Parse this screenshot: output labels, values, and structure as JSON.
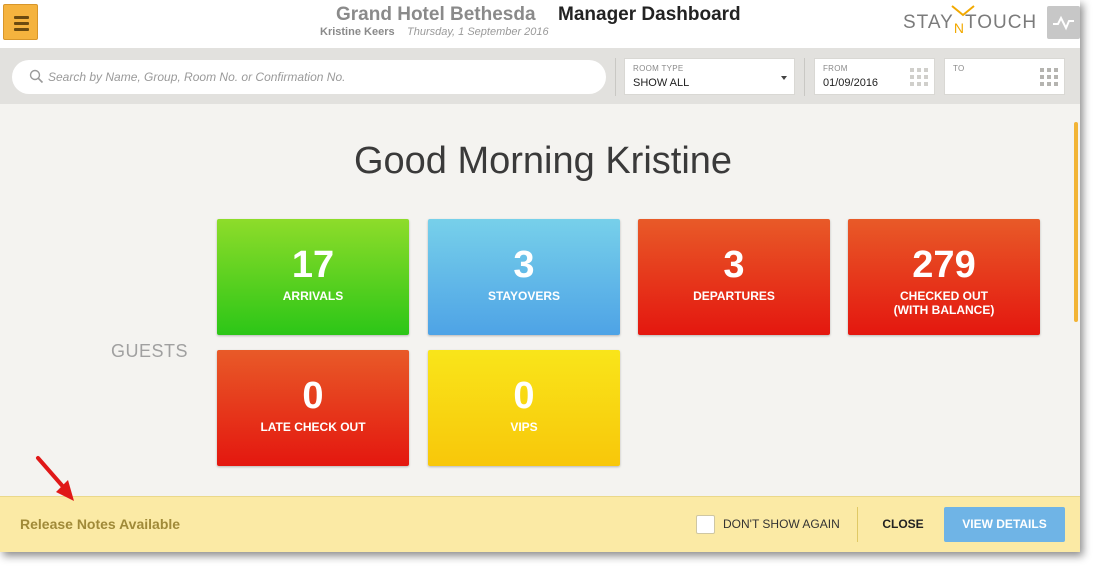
{
  "header": {
    "hotel_name": "Grand Hotel Bethesda",
    "page_title": "Manager Dashboard",
    "user_name": "Kristine Keers",
    "date": "Thursday, 1 September 2016",
    "brand": {
      "part1": "STAY",
      "mid": "N",
      "part2": "TOUCH"
    },
    "menu_icon": "hamburger-icon",
    "activity_icon": "activity-icon"
  },
  "search": {
    "placeholder": "Search by Name, Group, Room No. or Confirmation No.",
    "room_type_label": "ROOM TYPE",
    "room_type_value": "SHOW ALL",
    "from_label": "FROM",
    "from_value": "01/09/2016",
    "to_label": "TO",
    "to_value": ""
  },
  "main": {
    "greeting": "Good Morning Kristine",
    "section_label": "GUESTS",
    "tiles": [
      {
        "value": "17",
        "label": "ARRIVALS",
        "label2": ""
      },
      {
        "value": "3",
        "label": "STAYOVERS",
        "label2": ""
      },
      {
        "value": "3",
        "label": "DEPARTURES",
        "label2": ""
      },
      {
        "value": "279",
        "label": "CHECKED OUT",
        "label2": "(WITH BALANCE)"
      },
      {
        "value": "0",
        "label": "LATE CHECK OUT",
        "label2": ""
      },
      {
        "value": "0",
        "label": "VIPS",
        "label2": ""
      }
    ]
  },
  "notes_bar": {
    "text": "Release Notes Available",
    "dont_show_label": "DON'T SHOW AGAIN",
    "close_label": "CLOSE",
    "view_label": "VIEW DETAILS"
  },
  "colors": {
    "accent": "#f5b33e",
    "green": "#2cc617",
    "blue": "#4ea3e6",
    "red": "#e4170f",
    "yellow": "#f8c70a",
    "notes_bg": "#fbeaa5"
  }
}
